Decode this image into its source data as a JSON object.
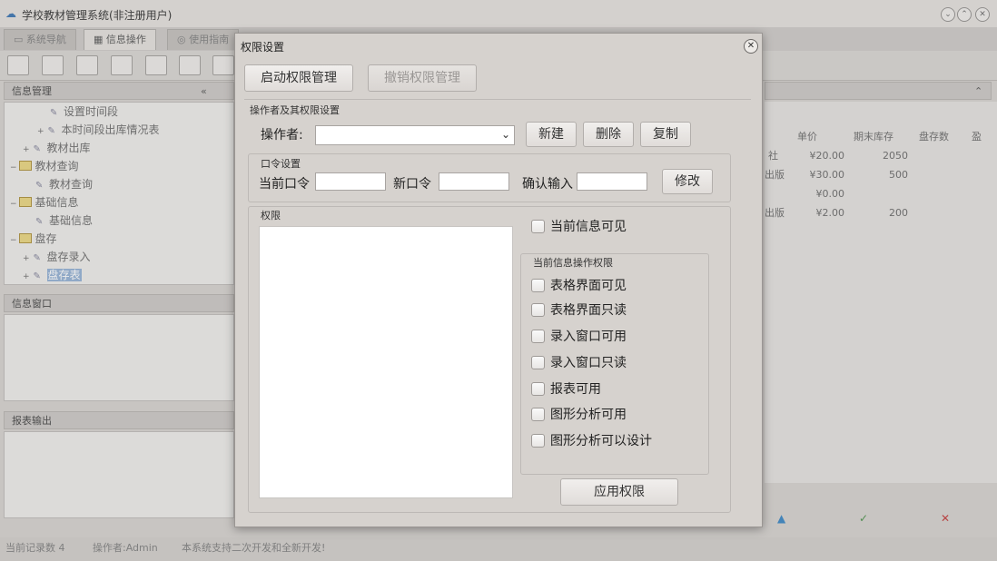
{
  "app": {
    "title": "学校教材管理系统(非注册用户)",
    "tabs": [
      "系统导航",
      "信息操作",
      "使用指南"
    ]
  },
  "left_panel": {
    "title": "信息管理",
    "tree": [
      {
        "label": "设置时间段",
        "kind": "leaf"
      },
      {
        "label": "本时间段出库情况表",
        "kind": "leaf"
      },
      {
        "label": "教材出库",
        "kind": "leaf"
      },
      {
        "label": "教材查询",
        "kind": "folder"
      },
      {
        "label": "教材查询",
        "kind": "leaf"
      },
      {
        "label": "基础信息",
        "kind": "folder"
      },
      {
        "label": "基础信息",
        "kind": "leaf"
      },
      {
        "label": "盘存",
        "kind": "folder"
      },
      {
        "label": "盘存录入",
        "kind": "leaf"
      },
      {
        "label": "盘存表",
        "kind": "leaf",
        "selected": true
      }
    ],
    "info_window": "信息窗口",
    "report_output": "报表输出"
  },
  "grid": {
    "headers": [
      "单价",
      "期末库存",
      "盘存数",
      "盈"
    ],
    "rows": [
      {
        "left": "社",
        "price": "¥20.00",
        "stock": "2050"
      },
      {
        "left": "出版",
        "price": "¥30.00",
        "stock": "500"
      },
      {
        "left": "",
        "price": "¥0.00",
        "stock": ""
      },
      {
        "left": "出版",
        "price": "¥2.00",
        "stock": "200"
      }
    ]
  },
  "statusbar": {
    "records": "当前记录数 4",
    "operator": "操作者:Admin",
    "note": "本系统支持二次开发和全新开发!"
  },
  "dialog": {
    "title": "权限设置",
    "start_button": "启动权限管理",
    "revoke_button": "撤销权限管理",
    "operator_group": "操作者及其权限设置",
    "operator_label": "操作者:",
    "operator_value": "",
    "new_button": "新建",
    "delete_button": "删除",
    "copy_button": "复制",
    "password_group": "口令设置",
    "current_password_label": "当前口令",
    "new_password_label": "新口令",
    "confirm_label": "确认输入",
    "modify_button": "修改",
    "permission_group": "权限",
    "current_info_visible": "当前信息可见",
    "current_ops_group": "当前信息操作权限",
    "permissions": [
      "表格界面可见",
      "表格界面只读",
      "录入窗口可用",
      "录入窗口只读",
      "报表可用",
      "图形分析可用",
      "图形分析可以设计"
    ],
    "apply_button": "应用权限"
  }
}
